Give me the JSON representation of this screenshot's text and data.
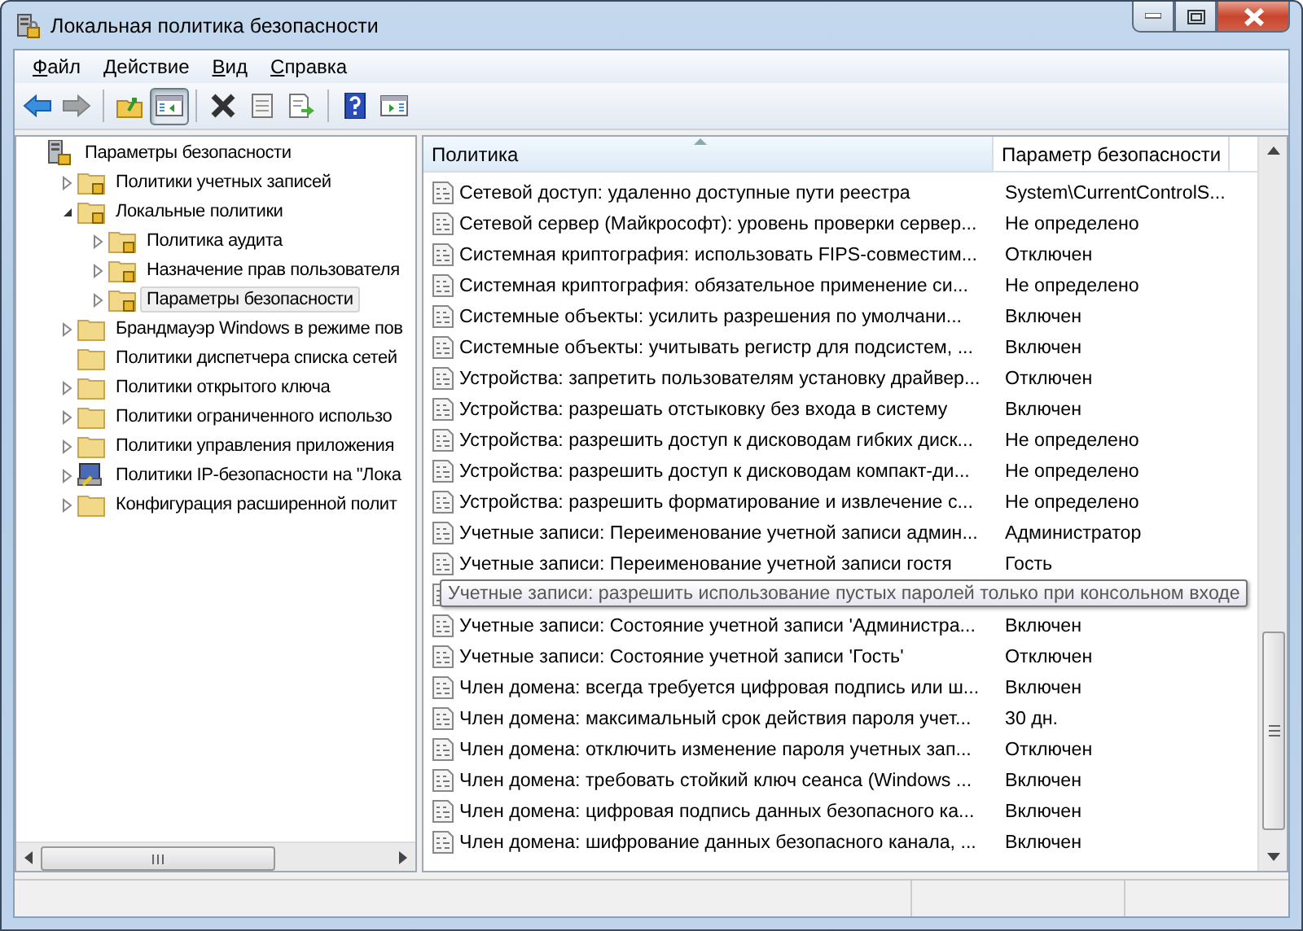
{
  "window": {
    "title": "Локальная политика безопасности"
  },
  "menu": [
    "Файл",
    "Действие",
    "Вид",
    "Справка"
  ],
  "toolbar": [
    {
      "kind": "back",
      "disabled": false,
      "pressed": false
    },
    {
      "kind": "forward",
      "disabled": true,
      "pressed": false
    },
    {
      "kind": "up",
      "disabled": false,
      "pressed": false
    },
    {
      "kind": "tree",
      "disabled": false,
      "pressed": true
    },
    {
      "kind": "delete",
      "disabled": false,
      "pressed": false
    },
    {
      "kind": "properties",
      "disabled": false,
      "pressed": false
    },
    {
      "kind": "export",
      "disabled": false,
      "pressed": false
    },
    {
      "kind": "help",
      "disabled": false,
      "pressed": false
    },
    {
      "kind": "action",
      "disabled": false,
      "pressed": false
    }
  ],
  "tree": [
    {
      "label": "Параметры безопасности",
      "kind": "root",
      "selected": false,
      "children": [
        {
          "label": "Политики учетных записей",
          "kind": "locked",
          "expanded": false,
          "selected": false
        },
        {
          "label": "Локальные политики",
          "kind": "locked",
          "expanded": true,
          "selected": false,
          "children": [
            {
              "label": "Политика аудита",
              "kind": "locked",
              "expanded": false,
              "selected": false
            },
            {
              "label": "Назначение прав пользователя",
              "kind": "locked",
              "expanded": false,
              "selected": false
            },
            {
              "label": "Параметры безопасности",
              "kind": "locked",
              "expanded": false,
              "selected": true
            }
          ]
        },
        {
          "label": "Брандмауэр Windows в режиме пов",
          "kind": "folder",
          "expanded": false,
          "selected": false
        },
        {
          "label": "Политики диспетчера списка сетей",
          "kind": "folder",
          "selected": false
        },
        {
          "label": "Политики открытого ключа",
          "kind": "folder",
          "expanded": false,
          "selected": false
        },
        {
          "label": "Политики ограниченного использо",
          "kind": "folder",
          "expanded": false,
          "selected": false
        },
        {
          "label": "Политики управления приложения",
          "kind": "folder",
          "expanded": false,
          "selected": false
        },
        {
          "label": "Политики IP-безопасности на \"Лока",
          "kind": "ipsec",
          "expanded": false,
          "selected": false
        },
        {
          "label": "Конфигурация расширенной полит",
          "kind": "folder",
          "expanded": false,
          "selected": false
        }
      ]
    }
  ],
  "table": {
    "columns": [
      {
        "label": "Политика",
        "sorted": true
      },
      {
        "label": "Параметр безопасности",
        "sorted": false
      }
    ],
    "rows": [
      {
        "policy": "Сетевой доступ: удаленно доступные пути реестра",
        "setting": "System\\CurrentControlS..."
      },
      {
        "policy": "Сетевой сервер (Майкрософт): уровень проверки сервер...",
        "setting": "Не определено"
      },
      {
        "policy": "Системная криптография: использовать FIPS-совместим...",
        "setting": "Отключен"
      },
      {
        "policy": "Системная криптография: обязательное применение си...",
        "setting": "Не определено"
      },
      {
        "policy": "Системные объекты: усилить разрешения по умолчани...",
        "setting": "Включен"
      },
      {
        "policy": "Системные объекты: учитывать регистр для подсистем, ...",
        "setting": "Включен"
      },
      {
        "policy": "Устройства: запретить пользователям установку драйвер...",
        "setting": "Отключен"
      },
      {
        "policy": "Устройства: разрешать отстыковку без входа в систему",
        "setting": "Включен"
      },
      {
        "policy": "Устройства: разрешить доступ к дисководам гибких диск...",
        "setting": "Не определено"
      },
      {
        "policy": "Устройства: разрешить доступ к дисководам компакт-ди...",
        "setting": "Не определено"
      },
      {
        "policy": "Устройства: разрешить форматирование и извлечение с...",
        "setting": "Не определено"
      },
      {
        "policy": "Учетные записи: Переименование учетной записи админ...",
        "setting": "Администратор"
      },
      {
        "policy": "Учетные записи: Переименование учетной записи гостя",
        "setting": "Гость"
      },
      {
        "kind": "tooltip",
        "text": "Учетные записи: разрешить использование пустых паролей только при консольном входе"
      },
      {
        "policy": "Учетные записи: Состояние учетной записи 'Администра...",
        "setting": "Включен"
      },
      {
        "policy": "Учетные записи: Состояние учетной записи 'Гость'",
        "setting": "Отключен"
      },
      {
        "policy": "Член домена: всегда требуется цифровая подпись или ш...",
        "setting": "Включен"
      },
      {
        "policy": "Член домена: максимальный срок действия пароля учет...",
        "setting": "30 дн."
      },
      {
        "policy": "Член домена: отключить изменение пароля учетных зап...",
        "setting": "Отключен"
      },
      {
        "policy": "Член домена: требовать стойкий ключ сеанса (Windows ...",
        "setting": "Включен"
      },
      {
        "policy": "Член домена: цифровая подпись данных безопасного ка...",
        "setting": "Включен"
      },
      {
        "policy": "Член домена: шифрование данных безопасного канала, ...",
        "setting": "Включен"
      }
    ]
  }
}
